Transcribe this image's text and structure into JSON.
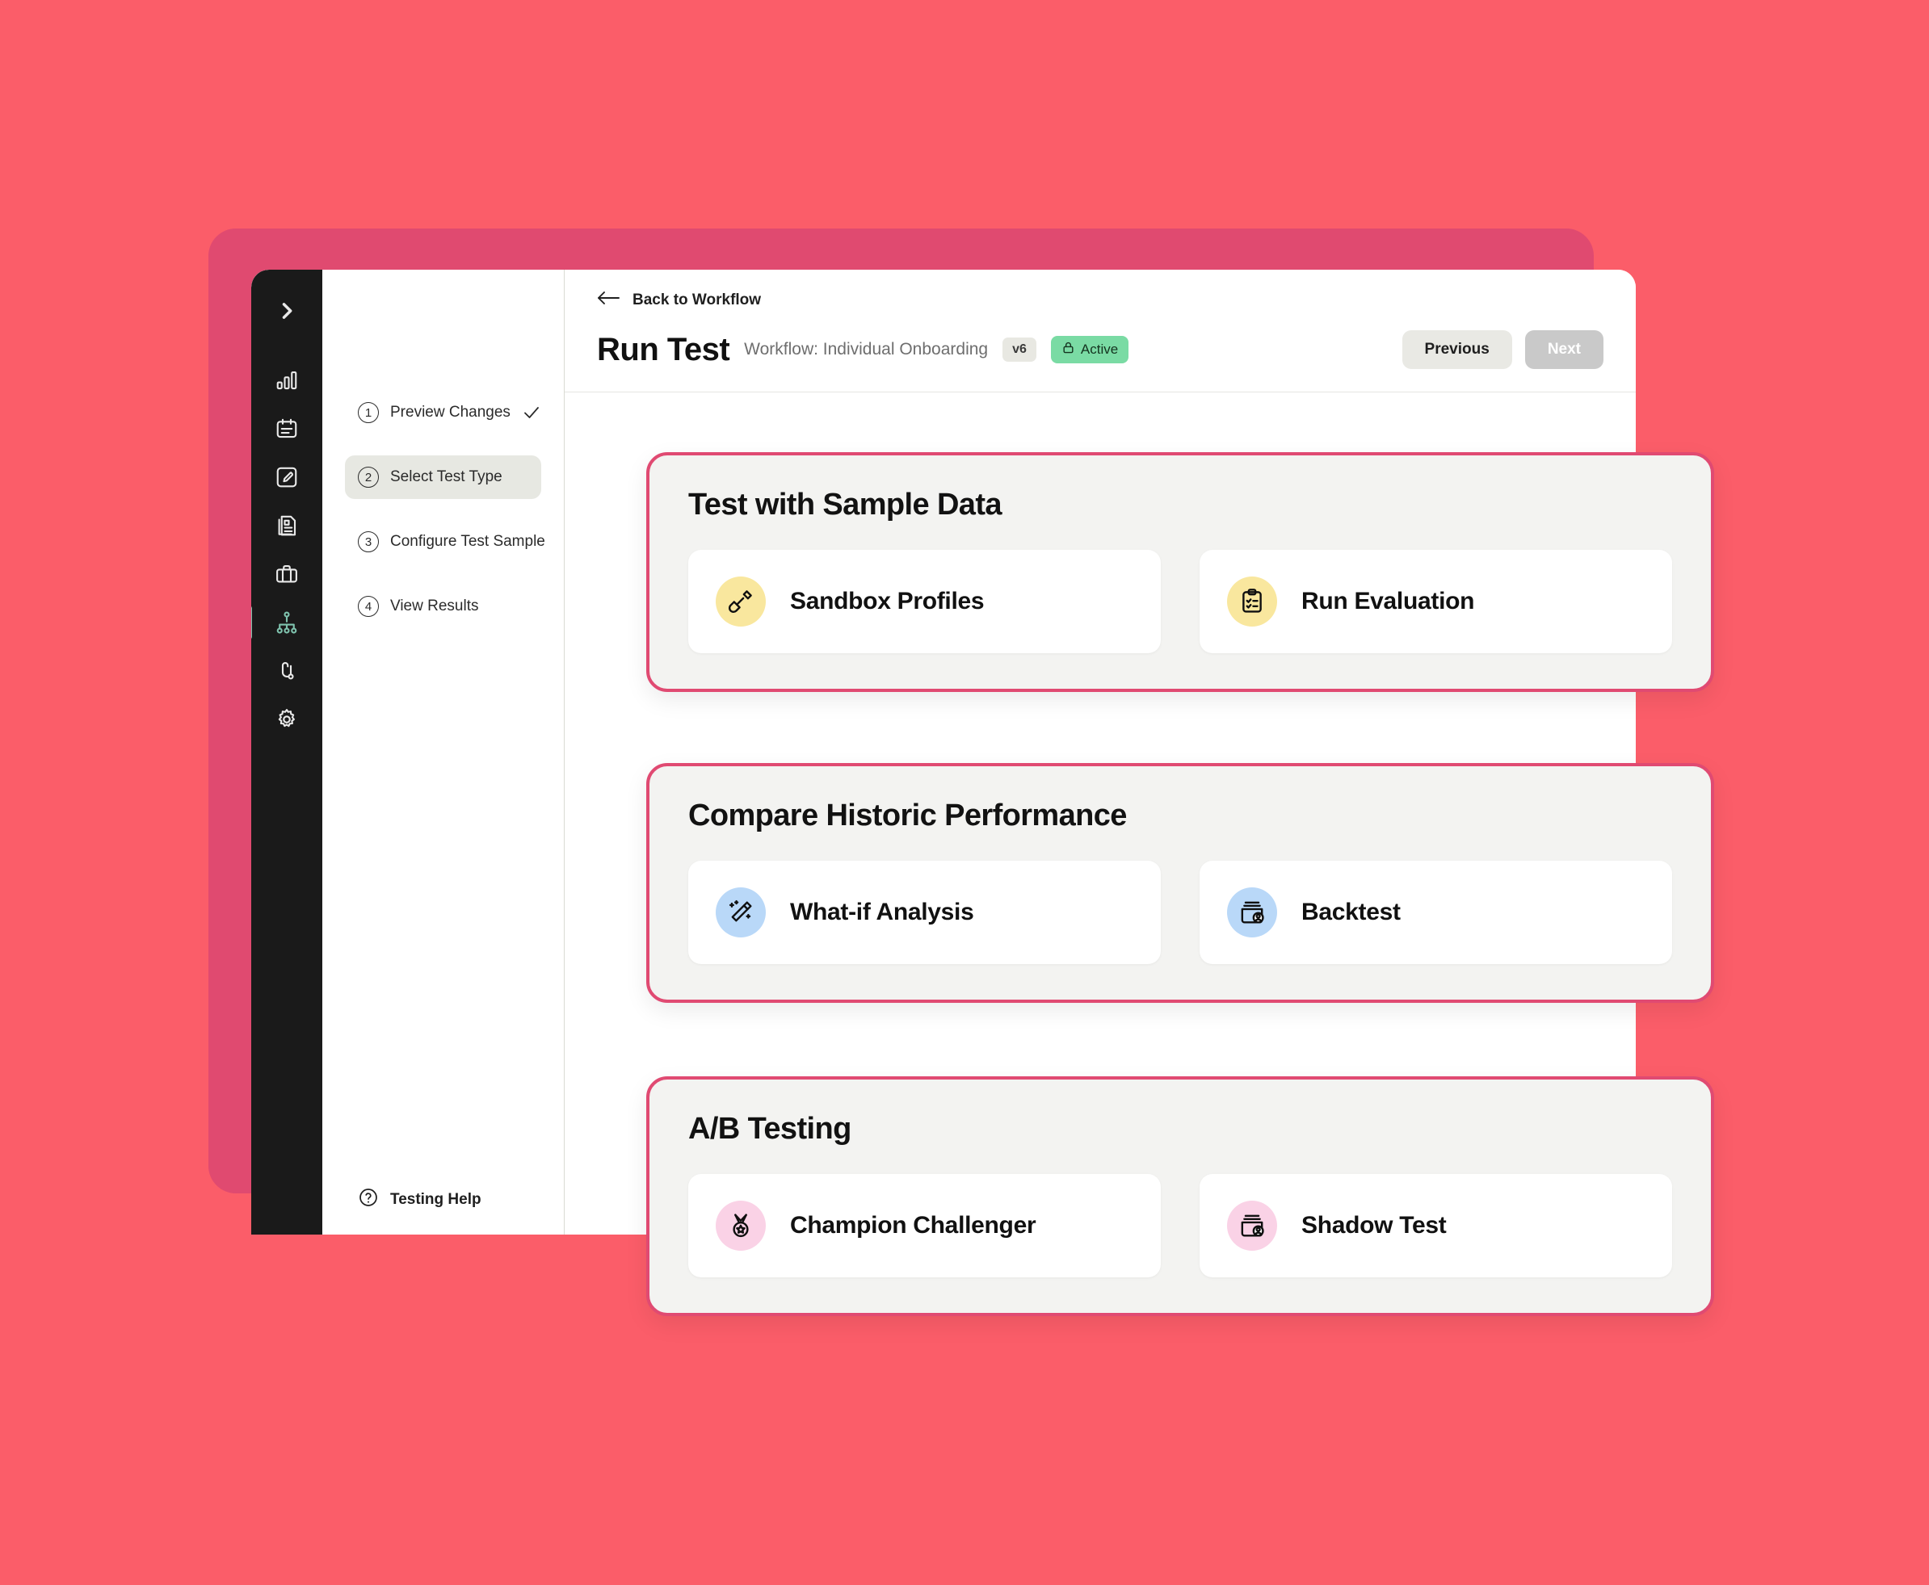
{
  "theme": {
    "page_background": "#FB5D69",
    "backdrop_panel": "#E04A70",
    "rail_background": "#1A1A1A",
    "accent_border": "#E04A72",
    "card_surface": "#F3F3F1",
    "active_rail": "#7FC3AE",
    "status_green": "#7ADBA4",
    "icon_yellow": "#F9E79E",
    "icon_blue": "#B9D8F8",
    "icon_pink": "#FAD2E6"
  },
  "nav_rail": {
    "items": [
      {
        "icon": "chevron-right-expand-icon",
        "label": "Expand",
        "active": false
      },
      {
        "icon": "bar-chart-icon",
        "label": "Analytics",
        "active": false
      },
      {
        "icon": "notes-card-icon",
        "label": "Notes",
        "active": false
      },
      {
        "icon": "edit-pencil-icon",
        "label": "Edit",
        "active": false
      },
      {
        "icon": "document-icon",
        "label": "Documents",
        "active": false
      },
      {
        "icon": "briefcase-icon",
        "label": "Cases",
        "active": false
      },
      {
        "icon": "workflow-tree-icon",
        "label": "Workflows",
        "active": true
      },
      {
        "icon": "git-branch-icon",
        "label": "Branches",
        "active": false
      },
      {
        "icon": "gear-icon",
        "label": "Settings",
        "active": false
      }
    ]
  },
  "header": {
    "back_label": "Back to Workflow",
    "back_icon": "arrow-left-icon",
    "title": "Run Test",
    "workflow_label": "Workflow: Individual Onboarding",
    "version_badge": "v6",
    "status_badge": "Active",
    "status_icon": "lock-icon",
    "previous_label": "Previous",
    "next_label": "Next"
  },
  "steps": {
    "items": [
      {
        "num": "1",
        "label": "Preview Changes",
        "state": "complete",
        "check": "check-icon"
      },
      {
        "num": "2",
        "label": "Select Test Type",
        "state": "current",
        "check": ""
      },
      {
        "num": "3",
        "label": "Configure Test Sample",
        "state": "upcoming",
        "check": ""
      },
      {
        "num": "4",
        "label": "View Results",
        "state": "upcoming",
        "check": ""
      }
    ],
    "help_label": "Testing Help",
    "help_icon": "question-circle-icon"
  },
  "sections": [
    {
      "title": "Test with Sample Data",
      "options": [
        {
          "label": "Sandbox Profiles",
          "icon": "shovel-icon",
          "tone": "yellow"
        },
        {
          "label": "Run Evaluation",
          "icon": "clipboard-checklist-icon",
          "tone": "yellow"
        }
      ]
    },
    {
      "title": "Compare Historic Performance",
      "options": [
        {
          "label": "What-if Analysis",
          "icon": "magic-wand-icon",
          "tone": "blue"
        },
        {
          "label": "Backtest",
          "icon": "archive-user-icon",
          "tone": "blue"
        }
      ]
    },
    {
      "title": "A/B Testing",
      "options": [
        {
          "label": "Champion Challenger",
          "icon": "medal-star-icon",
          "tone": "pink"
        },
        {
          "label": "Shadow Test",
          "icon": "archive-user-icon",
          "tone": "pink"
        }
      ]
    }
  ]
}
